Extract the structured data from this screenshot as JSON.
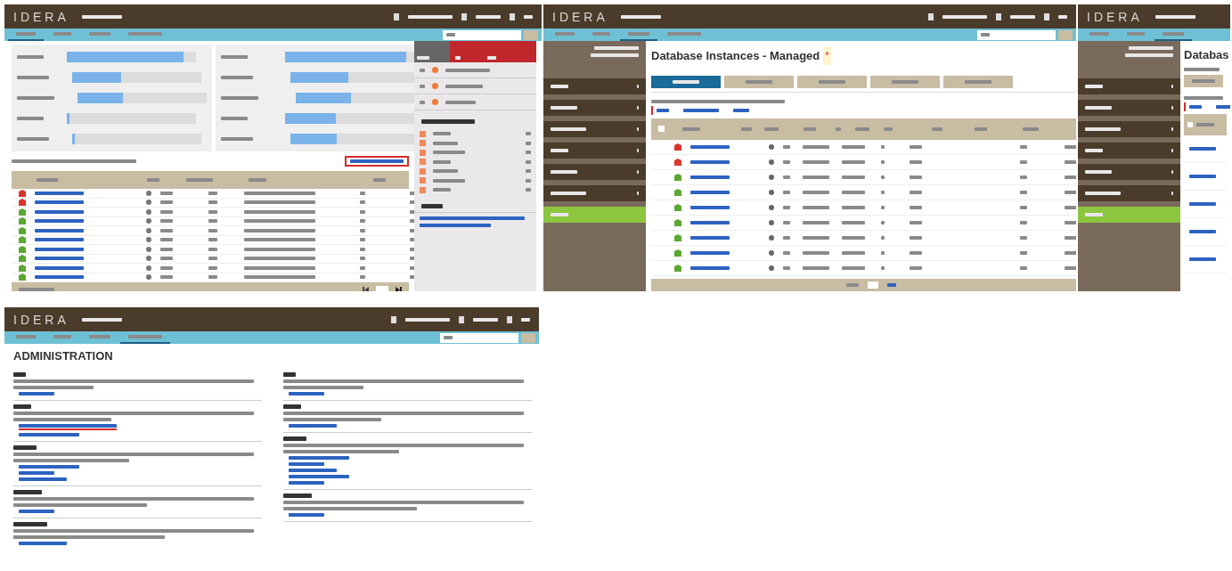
{
  "screens": [
    {
      "kind": "dashboard",
      "logo": "IDERA",
      "tabs": [
        {
          "selected": true
        },
        {
          "selected": false
        },
        {
          "selected": false
        },
        {
          "selected": false
        }
      ],
      "charts": [
        {
          "bars": [
            {
              "level": 0.9
            },
            {
              "level": 0.38
            },
            {
              "level": 0.35
            },
            {
              "level": 0.02
            },
            {
              "level": 0.02
            }
          ]
        },
        {
          "bars": [
            {
              "level": 0.94
            },
            {
              "level": 0.45
            },
            {
              "level": 0.43
            },
            {
              "level": 0.39
            },
            {
              "level": 0.36
            }
          ]
        }
      ],
      "summary_link": {
        "highlighted": true
      },
      "rows": [
        {
          "color": "#d9362c"
        },
        {
          "color": "#d9362c"
        },
        {
          "color": "#5aa832"
        },
        {
          "color": "#5aa832"
        },
        {
          "color": "#5aa832"
        },
        {
          "color": "#5aa832"
        },
        {
          "color": "#5aa832"
        },
        {
          "color": "#5aa832"
        },
        {
          "color": "#5aa832"
        },
        {
          "color": "#5aa832"
        }
      ]
    },
    {
      "kind": "instances",
      "logo": "IDERA",
      "tabs": [
        {
          "selected": false
        },
        {
          "selected": false
        },
        {
          "selected": true
        },
        {
          "selected": false
        }
      ],
      "title": "Database Instances - Managed",
      "title_mark": "*",
      "view_tabs": [
        {
          "selected": true
        },
        {
          "selected": false
        },
        {
          "selected": false
        },
        {
          "selected": false
        },
        {
          "selected": false
        }
      ],
      "nav": [
        {
          "selected": false
        },
        {
          "selected": false
        },
        {
          "selected": false
        },
        {
          "selected": false
        },
        {
          "selected": false
        },
        {
          "selected": false
        },
        {
          "selected": true
        }
      ],
      "links": {
        "highlighted": true
      },
      "rows": [
        {
          "color": "#d9362c"
        },
        {
          "color": "#d9362c"
        },
        {
          "color": "#5aa832"
        },
        {
          "color": "#5aa832"
        },
        {
          "color": "#5aa832"
        },
        {
          "color": "#5aa832"
        },
        {
          "color": "#5aa832"
        },
        {
          "color": "#5aa832"
        },
        {
          "color": "#5aa832"
        }
      ]
    },
    {
      "kind": "instances_cut",
      "logo": "IDERA",
      "tabs": [
        {
          "selected": false
        },
        {
          "selected": false
        },
        {
          "selected": true
        }
      ],
      "title": "Databas",
      "nav": [
        {
          "selected": false
        },
        {
          "selected": false
        },
        {
          "selected": false
        },
        {
          "selected": false
        },
        {
          "selected": false
        },
        {
          "selected": false
        },
        {
          "selected": true
        }
      ],
      "links": {
        "highlighted": true
      }
    },
    {
      "kind": "admin",
      "logo": "IDERA",
      "tabs": [
        {
          "selected": false
        },
        {
          "selected": false
        },
        {
          "selected": false
        },
        {
          "selected": true
        }
      ],
      "title": "ADMINISTRATION",
      "columns": [
        [
          {
            "links": [
              {
                "highlighted": false
              }
            ]
          },
          {
            "links": [
              {
                "highlighted": true
              },
              {
                "highlighted": false
              }
            ]
          },
          {
            "links": [
              {
                "highlighted": false
              },
              {
                "highlighted": false
              },
              {
                "highlighted": false
              }
            ]
          },
          {
            "links": [
              {
                "highlighted": false
              }
            ]
          },
          {
            "links": [
              {
                "highlighted": false
              }
            ]
          }
        ],
        [
          {
            "links": [
              {
                "highlighted": false
              }
            ]
          },
          {
            "links": [
              {
                "highlighted": false
              }
            ]
          },
          {
            "links": [
              {
                "highlighted": false
              },
              {
                "highlighted": false
              },
              {
                "highlighted": false
              },
              {
                "highlighted": false
              },
              {
                "highlighted": false
              }
            ]
          },
          {
            "links": [
              {
                "highlighted": false
              }
            ]
          }
        ]
      ]
    }
  ]
}
